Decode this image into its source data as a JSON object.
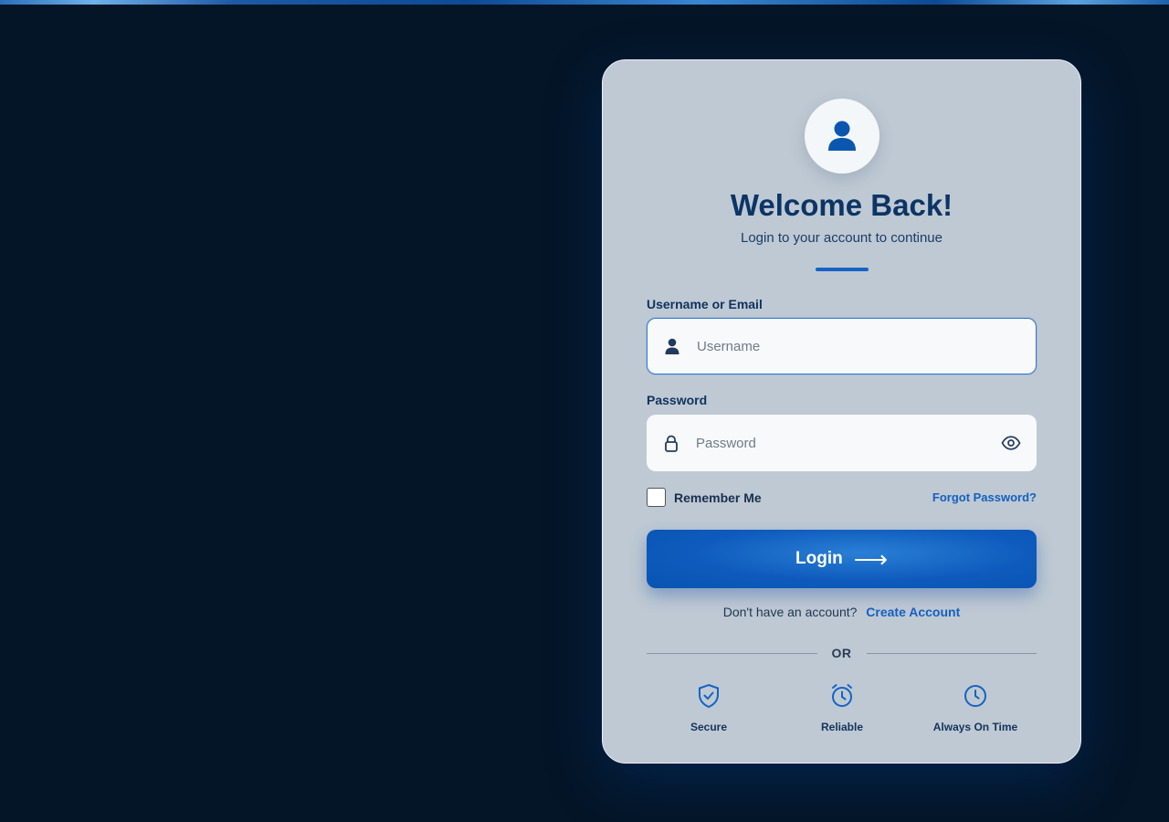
{
  "header": {
    "title": "Welcome Back!",
    "subtitle": "Login to your account to continue"
  },
  "form": {
    "username_label": "Username or Email",
    "username_placeholder": "Username",
    "password_label": "Password",
    "password_placeholder": "Password",
    "remember_label": "Remember Me",
    "forgot_label": "Forgot Password?",
    "login_label": "Login",
    "login_arrow": "⟶"
  },
  "signup": {
    "prompt": "Don't have an account?",
    "link": "Create Account"
  },
  "divider": {
    "text": "OR"
  },
  "features": [
    {
      "label": "Secure",
      "icon": "shield-check-icon"
    },
    {
      "label": "Reliable",
      "icon": "alarm-clock-icon"
    },
    {
      "label": "Always On Time",
      "icon": "clock-icon"
    }
  ],
  "colors": {
    "accent": "#1563c4",
    "title": "#0c3566",
    "card": "#bfc9d3",
    "background": "#041527"
  }
}
